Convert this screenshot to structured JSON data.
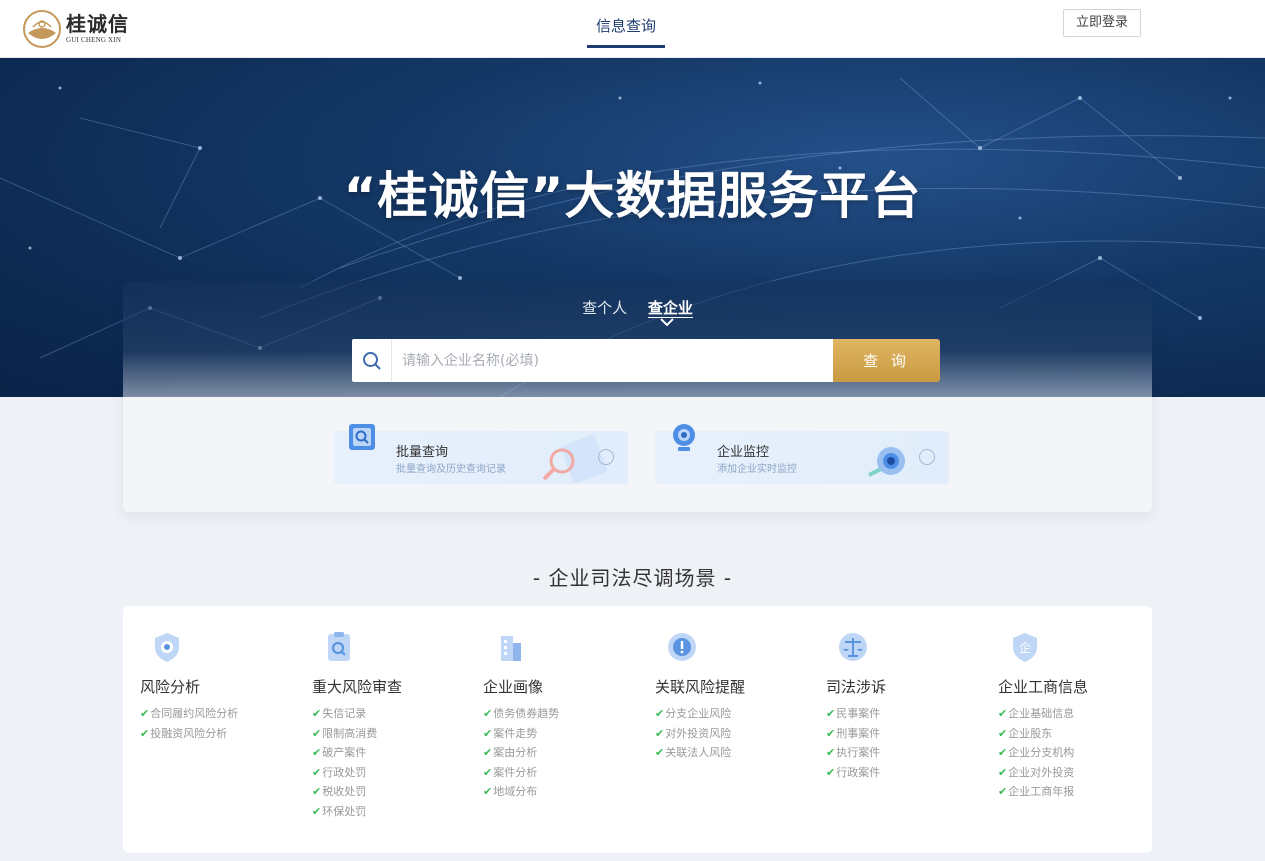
{
  "header": {
    "logo": {
      "cn": "桂诚信",
      "en": "GUI CHENG XIN"
    },
    "nav_tab": "信息查询",
    "login": "立即登录"
  },
  "banner": {
    "title": "“桂诚信”大数据服务平台"
  },
  "search": {
    "tabs": [
      "查个人",
      "查企业"
    ],
    "active_tab": "查企业",
    "placeholder": "请输入企业名称(必填)",
    "button": "查 询"
  },
  "features": [
    {
      "title": "批量查询",
      "subtitle": "批量查询及历史查询记录",
      "icon": "document-search-icon"
    },
    {
      "title": "企业监控",
      "subtitle": "添加企业实时监控",
      "icon": "camera-monitor-icon"
    }
  ],
  "section_title": "- 企业司法尽调场景 -",
  "scenes": [
    {
      "title": "风险分析",
      "icon": "shield-icon",
      "items": [
        "合同履约风险分析",
        "投融资风险分析"
      ]
    },
    {
      "title": "重大风险审查",
      "icon": "clipboard-search-icon",
      "items": [
        "失信记录",
        "限制高消费",
        "破产案件",
        "行政处罚",
        "税收处罚",
        "环保处罚"
      ]
    },
    {
      "title": "企业画像",
      "icon": "building-icon",
      "items": [
        "债务债券趋势",
        "案件走势",
        "案由分析",
        "案件分析",
        "地域分布"
      ]
    },
    {
      "title": "关联风险提醒",
      "icon": "alert-icon",
      "items": [
        "分支企业风险",
        "对外投资风险",
        "关联法人风险"
      ]
    },
    {
      "title": "司法涉诉",
      "icon": "scales-icon",
      "items": [
        "民事案件",
        "刑事案件",
        "执行案件",
        "行政案件"
      ]
    },
    {
      "title": "企业工商信息",
      "icon": "enterprise-shield-icon",
      "items": [
        "企业基础信息",
        "企业股东",
        "企业分支机构",
        "企业对外投资",
        "企业工商年报"
      ]
    }
  ],
  "colors": {
    "primary": "#1f3c6e",
    "gold": "#c89a42",
    "tick": "#3cba57",
    "banner": "#0d2a52"
  }
}
